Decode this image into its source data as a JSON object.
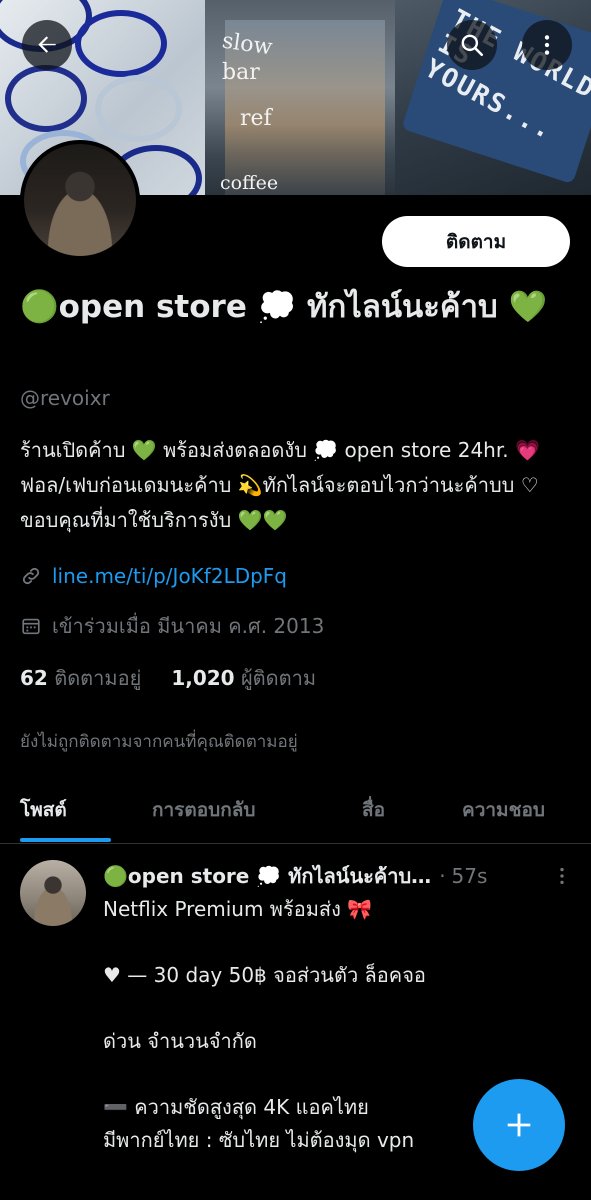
{
  "header": {
    "back_icon": "arrow-left-icon",
    "search_icon": "search-icon",
    "more_icon": "more-vertical-icon",
    "banner_text": {
      "slow": "slow",
      "bar": "bar",
      "ref": "ref",
      "coffee": "coffee",
      "rug": "THE WORLD IS YOURS..."
    }
  },
  "profile": {
    "follow_label": "ติดตาม",
    "display_name": "🟢open store 💭 ทักไลน์นะค้าบ 💚",
    "handle": "@revoixr",
    "bio": "ร้านเปิดค้าบ 💚 พร้อมส่งตลอดงับ 💭 open store 24hr. 💗 ฟอล/เฟบก่อนเดมนะค้าบ 💫ทักไลน์จะตอบไวกว่านะค้าบบ ♡ ขอบคุณที่มาใช้บริการงับ 💚💚",
    "link": "line.me/ti/p/JoKf2LDpFq",
    "joined": "เข้าร่วมเมื่อ มีนาคม ค.ศ. 2013",
    "following_count": "62",
    "following_label": "ติดตามอยู่",
    "followers_count": "1,020",
    "followers_label": "ผู้ติดตาม",
    "not_followed_note": "ยังไม่ถูกติดตามจากคนที่คุณติดตามอยู่"
  },
  "tabs": [
    {
      "label": "โพสต์",
      "active": true
    },
    {
      "label": "การตอบกลับ",
      "active": false
    },
    {
      "label": "สื่อ",
      "active": false
    },
    {
      "label": "ความชอบ",
      "active": false
    }
  ],
  "post": {
    "author": "🟢open store 💭 ทักไลน์นะค้าบ…",
    "separator": "·",
    "time": "57s",
    "lines": [
      "Netflix Premium พร้อมส่ง 🎀",
      "♥ — 30 day 50฿ จอส่วนตัว ล็อคจอ",
      "ด่วน จำนวนจำกัด",
      "➖ ความชัดสูงสุด 4K แอคไทย",
      " มีพากย์ไทย : ซับไทย ไม่ต้องมุด vpn"
    ]
  },
  "fab": {
    "icon": "plus-icon"
  },
  "colors": {
    "accent": "#1d9bf0",
    "text": "#e7e9ea",
    "muted": "#71767b",
    "background": "#000000"
  }
}
